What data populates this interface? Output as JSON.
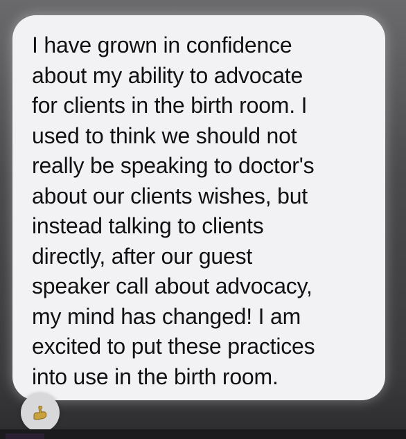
{
  "message": {
    "lines": [
      "I have grown in confidence",
      "about my ability to advocate",
      "for clients in the birth room. I",
      "used to think we should not",
      "really be speaking to doctor's",
      "about our clients wishes, but",
      "instead talking to clients",
      "directly, after our guest",
      "speaker call about advocacy,",
      "my mind has changed! I am",
      "excited to put these practices",
      "into use in the birth room."
    ]
  },
  "reaction": {
    "icon": "flexed-bicep-icon",
    "color": "#c8a23c"
  }
}
